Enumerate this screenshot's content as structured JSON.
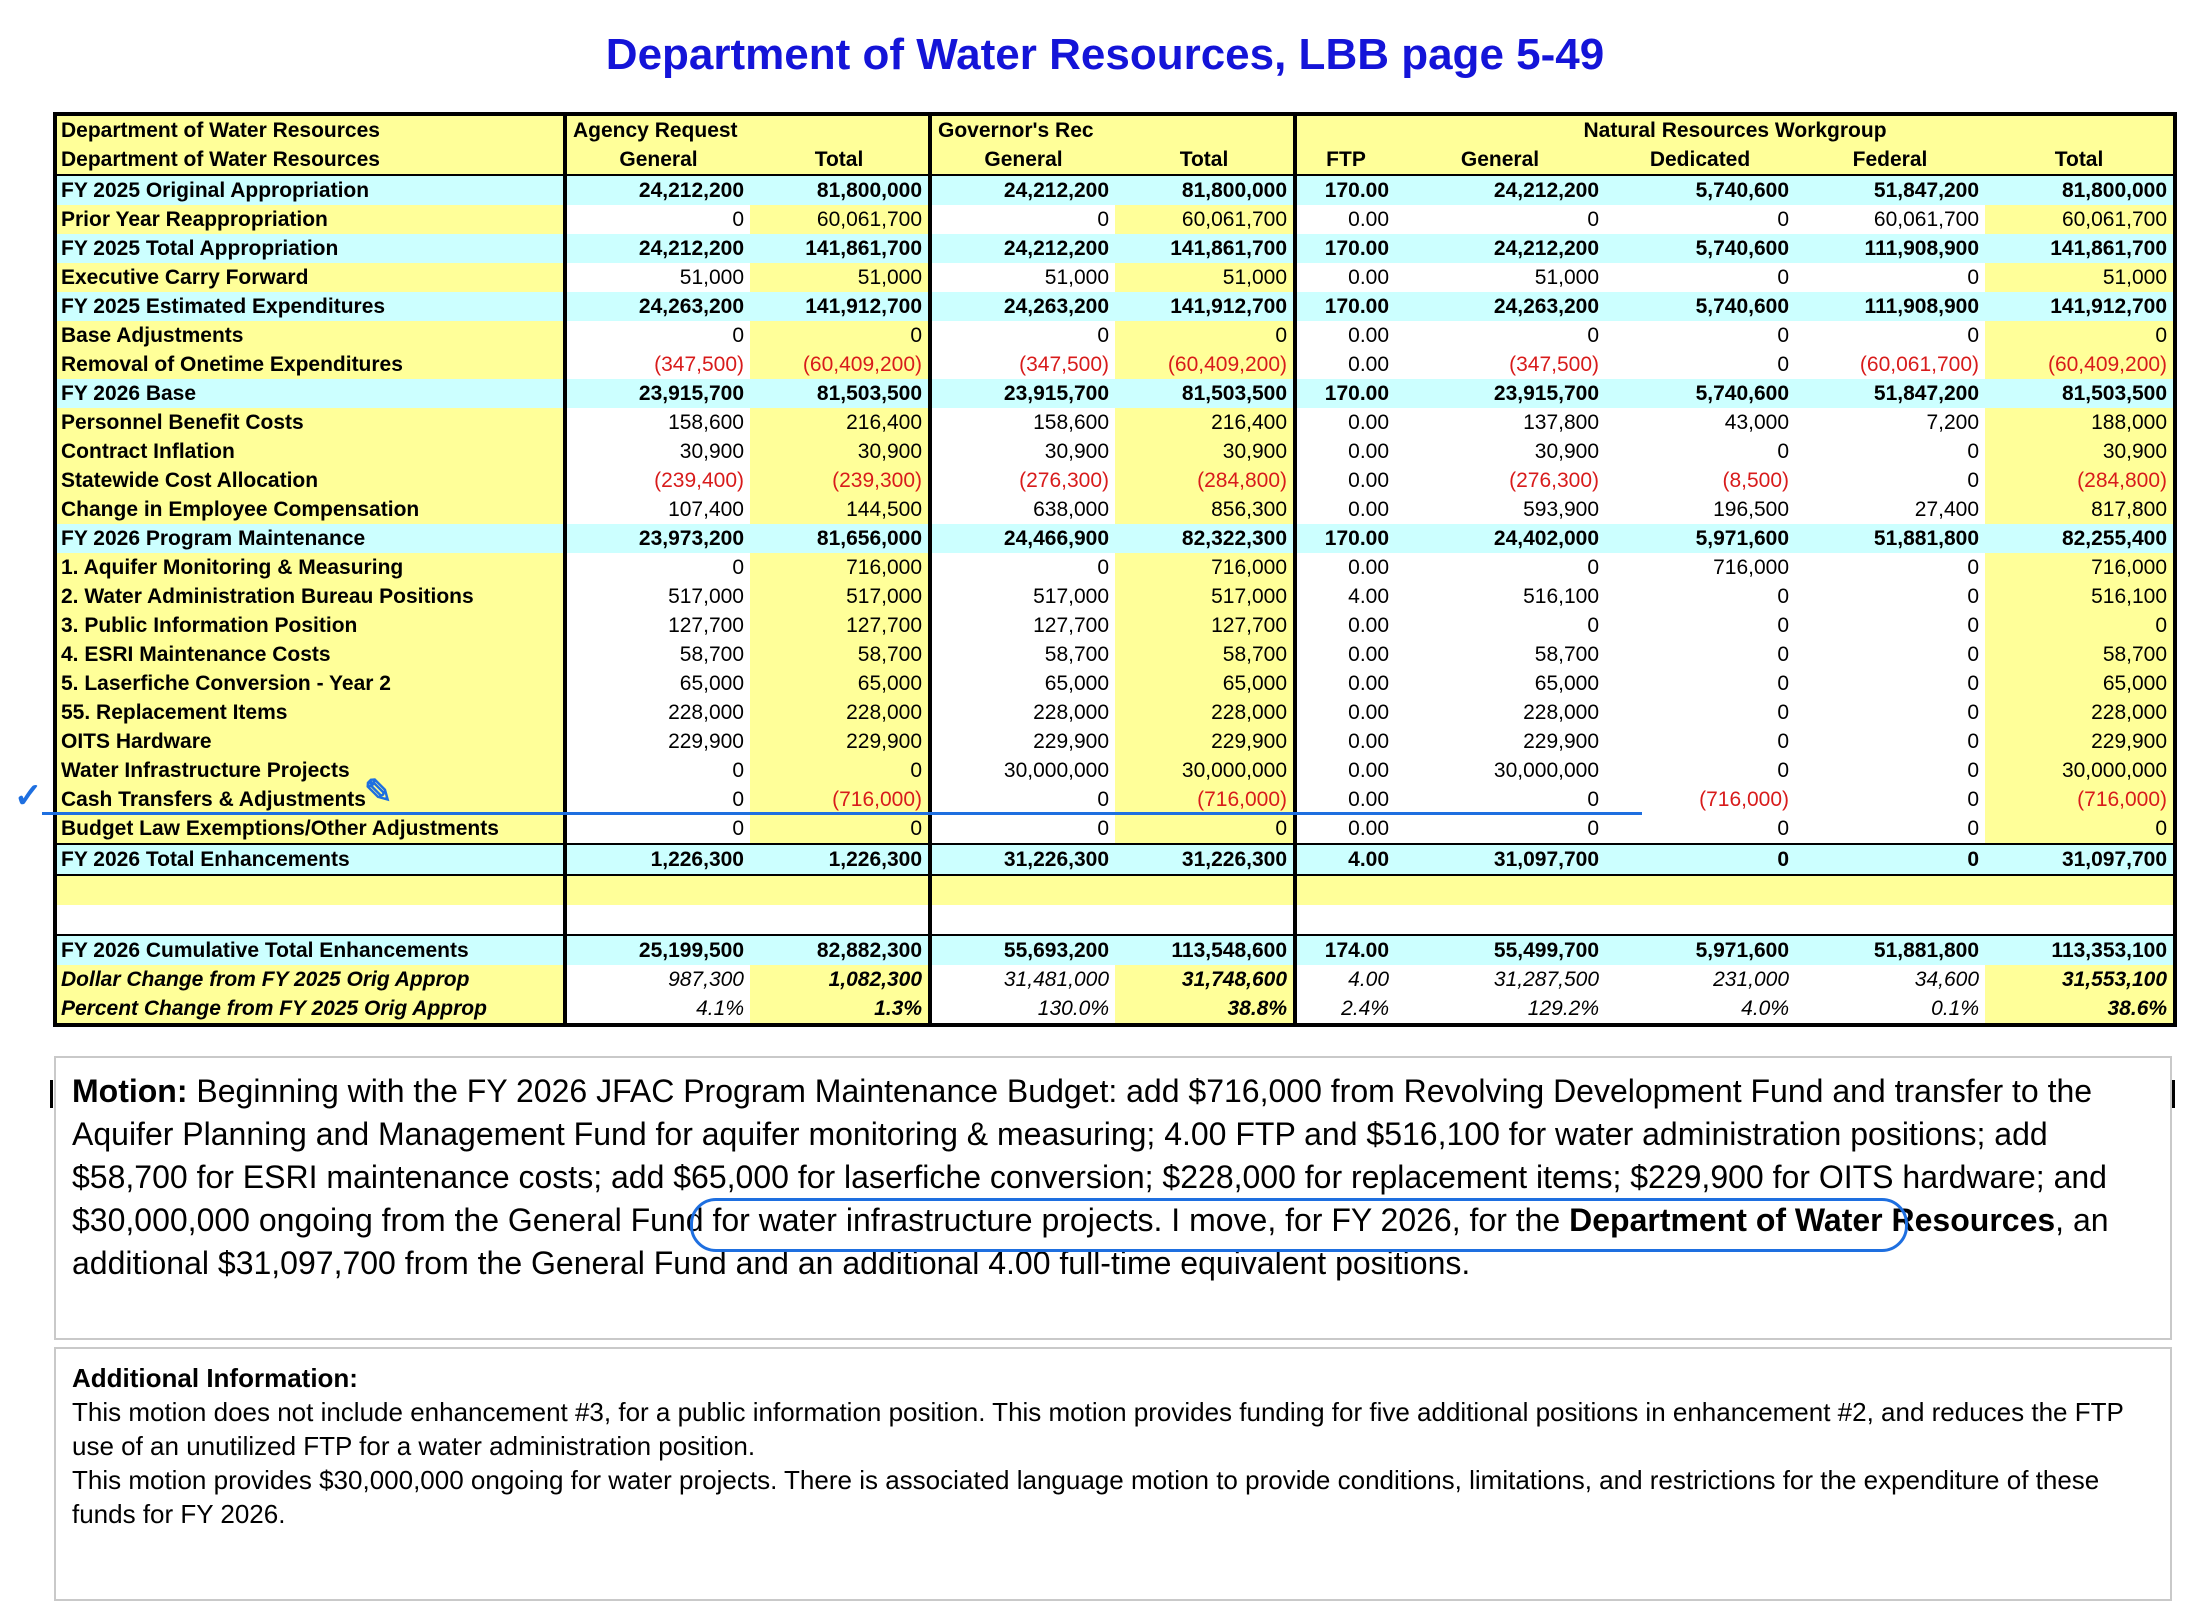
{
  "title": "Department of Water Resources, LBB page 5-49",
  "headers": {
    "row1": {
      "dept": "Department of Water Resources",
      "agency": "Agency Request",
      "governor": "Governor's Rec",
      "workgroup": "Natural Resources Workgroup"
    },
    "row2": [
      "Department of Water Resources",
      "General",
      "Total",
      "General",
      "Total",
      "FTP",
      "General",
      "Dedicated",
      "Federal",
      "Total"
    ]
  },
  "rows": [
    {
      "label": "FY 2025 Original Appropriation",
      "values": [
        "24,212,200",
        "81,800,000",
        "24,212,200",
        "81,800,000",
        "170.00",
        "24,212,200",
        "5,740,600",
        "51,847,200",
        "81,800,000"
      ]
    },
    {
      "label": "Prior Year Reappropriation",
      "values": [
        "0",
        "60,061,700",
        "0",
        "60,061,700",
        "0.00",
        "0",
        "0",
        "60,061,700",
        "60,061,700"
      ]
    },
    {
      "label": "FY 2025 Total Appropriation",
      "values": [
        "24,212,200",
        "141,861,700",
        "24,212,200",
        "141,861,700",
        "170.00",
        "24,212,200",
        "5,740,600",
        "111,908,900",
        "141,861,700"
      ]
    },
    {
      "label": "Executive Carry Forward",
      "values": [
        "51,000",
        "51,000",
        "51,000",
        "51,000",
        "0.00",
        "51,000",
        "0",
        "0",
        "51,000"
      ]
    },
    {
      "label": "FY 2025 Estimated Expenditures",
      "values": [
        "24,263,200",
        "141,912,700",
        "24,263,200",
        "141,912,700",
        "170.00",
        "24,263,200",
        "5,740,600",
        "111,908,900",
        "141,912,700"
      ]
    },
    {
      "label": "Base Adjustments",
      "values": [
        "0",
        "0",
        "0",
        "0",
        "0.00",
        "0",
        "0",
        "0",
        "0"
      ]
    },
    {
      "label": "Removal of Onetime Expenditures",
      "values": [
        "(347,500)",
        "(60,409,200)",
        "(347,500)",
        "(60,409,200)",
        "0.00",
        "(347,500)",
        "0",
        "(60,061,700)",
        "(60,409,200)"
      ]
    },
    {
      "label": "FY 2026 Base",
      "values": [
        "23,915,700",
        "81,503,500",
        "23,915,700",
        "81,503,500",
        "170.00",
        "23,915,700",
        "5,740,600",
        "51,847,200",
        "81,503,500"
      ]
    },
    {
      "label": "Personnel Benefit Costs",
      "values": [
        "158,600",
        "216,400",
        "158,600",
        "216,400",
        "0.00",
        "137,800",
        "43,000",
        "7,200",
        "188,000"
      ]
    },
    {
      "label": "Contract Inflation",
      "values": [
        "30,900",
        "30,900",
        "30,900",
        "30,900",
        "0.00",
        "30,900",
        "0",
        "0",
        "30,900"
      ]
    },
    {
      "label": "Statewide Cost Allocation",
      "values": [
        "(239,400)",
        "(239,300)",
        "(276,300)",
        "(284,800)",
        "0.00",
        "(276,300)",
        "(8,500)",
        "0",
        "(284,800)"
      ]
    },
    {
      "label": "Change in Employee Compensation",
      "values": [
        "107,400",
        "144,500",
        "638,000",
        "856,300",
        "0.00",
        "593,900",
        "196,500",
        "27,400",
        "817,800"
      ]
    },
    {
      "label": "FY 2026 Program Maintenance",
      "values": [
        "23,973,200",
        "81,656,000",
        "24,466,900",
        "82,322,300",
        "170.00",
        "24,402,000",
        "5,971,600",
        "51,881,800",
        "82,255,400"
      ]
    },
    {
      "label": "1. Aquifer Monitoring & Measuring",
      "values": [
        "0",
        "716,000",
        "0",
        "716,000",
        "0.00",
        "0",
        "716,000",
        "0",
        "716,000"
      ]
    },
    {
      "label": "2. Water Administration Bureau Positions",
      "values": [
        "517,000",
        "517,000",
        "517,000",
        "517,000",
        "4.00",
        "516,100",
        "0",
        "0",
        "516,100"
      ]
    },
    {
      "label": "3. Public Information Position",
      "values": [
        "127,700",
        "127,700",
        "127,700",
        "127,700",
        "0.00",
        "0",
        "0",
        "0",
        "0"
      ]
    },
    {
      "label": "4. ESRI Maintenance Costs",
      "values": [
        "58,700",
        "58,700",
        "58,700",
        "58,700",
        "0.00",
        "58,700",
        "0",
        "0",
        "58,700"
      ]
    },
    {
      "label": "5. Laserfiche Conversion - Year 2",
      "values": [
        "65,000",
        "65,000",
        "65,000",
        "65,000",
        "0.00",
        "65,000",
        "0",
        "0",
        "65,000"
      ]
    },
    {
      "label": "55. Replacement Items",
      "values": [
        "228,000",
        "228,000",
        "228,000",
        "228,000",
        "0.00",
        "228,000",
        "0",
        "0",
        "228,000"
      ]
    },
    {
      "label": "OITS Hardware",
      "values": [
        "229,900",
        "229,900",
        "229,900",
        "229,900",
        "0.00",
        "229,900",
        "0",
        "0",
        "229,900"
      ]
    },
    {
      "label": "Water Infrastructure Projects",
      "values": [
        "0",
        "0",
        "30,000,000",
        "30,000,000",
        "0.00",
        "30,000,000",
        "0",
        "0",
        "30,000,000"
      ]
    },
    {
      "label": "Cash Transfers & Adjustments",
      "values": [
        "0",
        "(716,000)",
        "0",
        "(716,000)",
        "0.00",
        "0",
        "(716,000)",
        "0",
        "(716,000)"
      ]
    },
    {
      "label": "Budget Law Exemptions/Other Adjustments",
      "values": [
        "0",
        "0",
        "0",
        "0",
        "0.00",
        "0",
        "0",
        "0",
        "0"
      ]
    },
    {
      "label": "FY 2026 Total Enhancements",
      "values": [
        "1,226,300",
        "1,226,300",
        "31,226,300",
        "31,226,300",
        "4.00",
        "31,097,700",
        "0",
        "0",
        "31,097,700"
      ]
    },
    {
      "label": "FY 2026 Cumulative Total Enhancements",
      "values": [
        "25,199,500",
        "82,882,300",
        "55,693,200",
        "113,548,600",
        "174.00",
        "55,499,700",
        "5,971,600",
        "51,881,800",
        "113,353,100"
      ]
    },
    {
      "label": "Dollar Change from FY 2025 Orig Approp",
      "values": [
        "987,300",
        "1,082,300",
        "31,481,000",
        "31,748,600",
        "4.00",
        "31,287,500",
        "231,000",
        "34,600",
        "31,553,100"
      ]
    },
    {
      "label": "Percent Change from FY 2025 Orig Approp",
      "values": [
        "4.1%",
        "1.3%",
        "130.0%",
        "38.8%",
        "2.4%",
        "129.2%",
        "4.0%",
        "0.1%",
        "38.6%"
      ]
    }
  ],
  "motion": {
    "label": "Motion:",
    "text1": " Beginning with the FY 2026 JFAC Program Maintenance Budget: add $716,000 from Revolving Development Fund and transfer to the Aquifer Planning and Management Fund for aquifer monitoring & measuring; 4.00 FTP and $516,100 for water administration positions; add $58,700 for ESRI maintenance costs; add $65,000 for laserfiche conversion; $228,000 for replacement items; $229,900 for OITS hardware; and ",
    "highlight": "$30,000,000 ongoing from the General Fund for water infrastructure projects.",
    "text2": " I move, for FY 2026, for the ",
    "dept": "Department of Water Resources",
    "text3": ", an additional $31,097,700 from the General Fund and an additional 4.00 full-time equivalent positions."
  },
  "additional": {
    "heading": "Additional Information:",
    "p1": "This motion does not include enhancement #3, for a public information position.  This motion provides funding for five additional positions in enhancement #2, and reduces the FTP use of an unutilized FTP for a water administration position.",
    "p2": "This motion provides $30,000,000 ongoing for water projects. There is associated language motion to provide conditions, limitations, and restrictions for the expenditure of these funds for FY 2026."
  },
  "annotation_colors": {
    "pen": "#1e6fe0",
    "title": "#1414d8",
    "negative": "#d81b1b",
    "yellow": "#ffff99",
    "cyan": "#ccffff"
  }
}
